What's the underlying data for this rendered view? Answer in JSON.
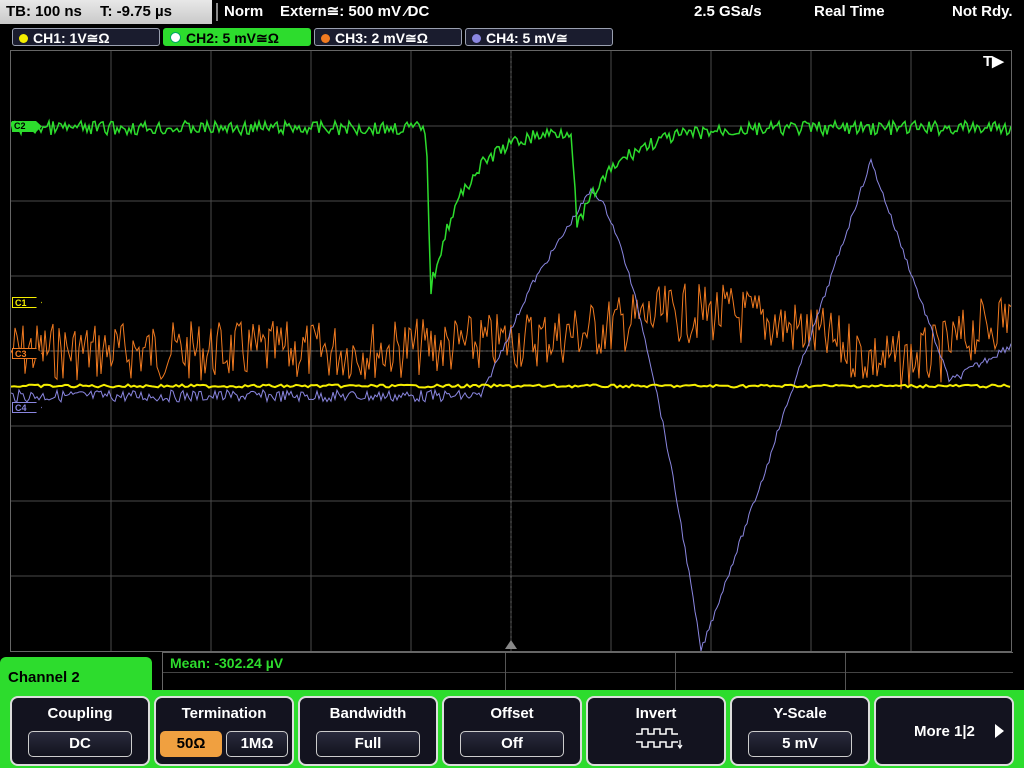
{
  "status": {
    "timebase": "TB: 100 ns",
    "trigger_time": "T: -9.75 µs",
    "mode": "Norm",
    "trigger_source": "Extern≅: 500 mV ⁄DC",
    "sample_rate": "2.5 GSa/s",
    "acq_mode": "Real Time",
    "run_state": "Not Rdy."
  },
  "channels": [
    {
      "label": "CH1: 1V≅Ω",
      "color": "#f5ee00"
    },
    {
      "label": "CH2: 5 mV≅Ω",
      "color": "#2ddc2d",
      "active": true
    },
    {
      "label": "CH3: 2 mV≅Ω",
      "color": "#f07a20"
    },
    {
      "label": "CH4: 5 mV≅",
      "color": "#8a86e0"
    }
  ],
  "markers": {
    "c1": "C1",
    "c2": "C2",
    "c3": "C3",
    "c4": "C4"
  },
  "trigger_flag": "T▶",
  "measurement": {
    "text": "Mean: -302.24 µV"
  },
  "panel": {
    "title": "Channel 2"
  },
  "softkeys": {
    "coupling": {
      "title": "Coupling",
      "value": "DC"
    },
    "termination": {
      "title": "Termination",
      "options": [
        "50Ω",
        "1MΩ"
      ],
      "selected": "50Ω"
    },
    "bandwidth": {
      "title": "Bandwidth",
      "value": "Full"
    },
    "offset": {
      "title": "Offset",
      "value": "Off"
    },
    "invert": {
      "title": "Invert",
      "icon": "invert-waveform-icon"
    },
    "yscale": {
      "title": "Y-Scale",
      "value": "5 mV"
    },
    "more": {
      "label": "More 1|2"
    }
  },
  "colors": {
    "ch1": "#f5ee00",
    "ch2": "#2ddc2d",
    "ch3": "#f07a20",
    "ch4": "#8a86e0",
    "grid": "#4a4a4a",
    "accent": "#f0a040"
  }
}
